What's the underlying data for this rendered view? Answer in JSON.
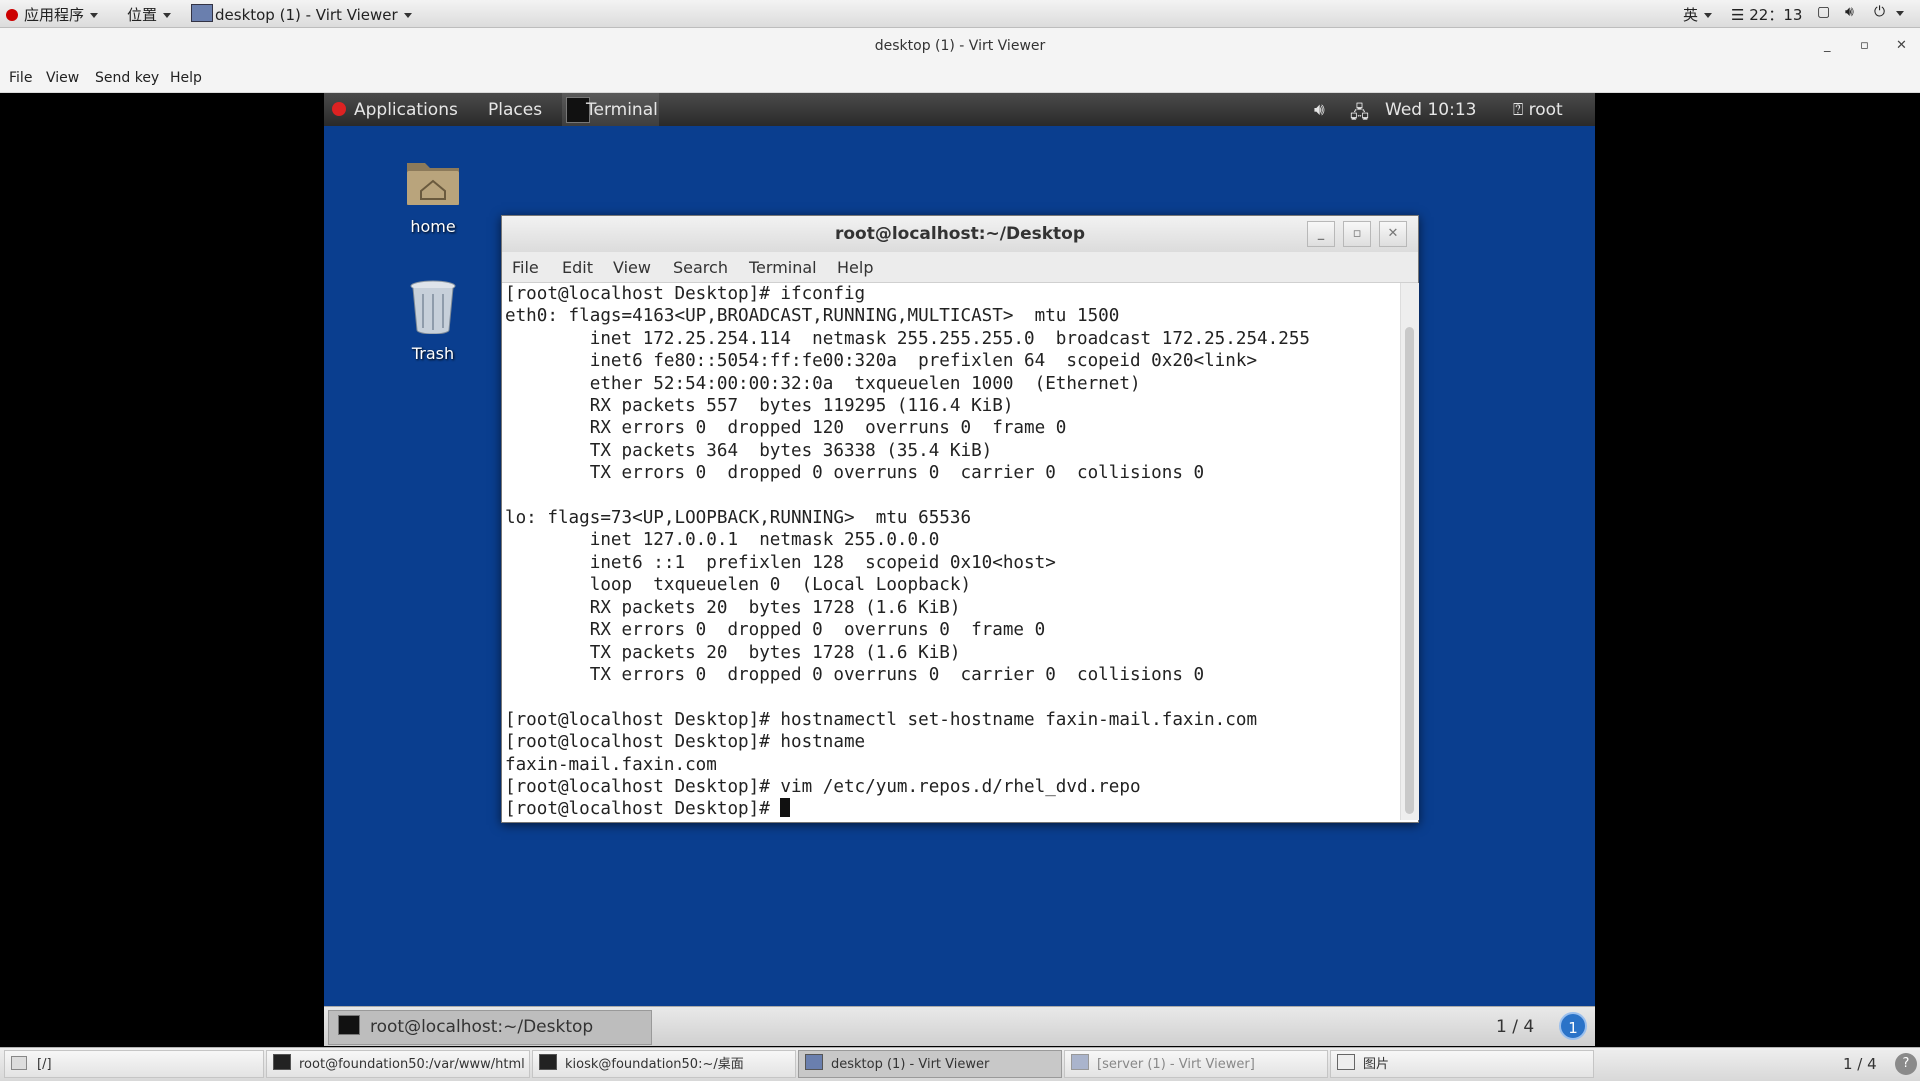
{
  "host_top": {
    "apps_menu": "应用程序",
    "places_menu": "位置",
    "window_menu": "desktop (1) - Virt Viewer",
    "input_method": "英",
    "clock": "22：13"
  },
  "viewer": {
    "title": "desktop (1) - Virt Viewer",
    "menu": [
      "File",
      "View",
      "Send key",
      "Help"
    ]
  },
  "guest": {
    "top_panel": {
      "applications": "Applications",
      "places": "Places",
      "terminal": "Terminal",
      "clock": "Wed 10:13",
      "user": "root"
    },
    "desktop_icons": [
      {
        "label": "home",
        "icon": "home-folder-icon"
      },
      {
        "label": "Trash",
        "icon": "trash-icon"
      }
    ],
    "terminal": {
      "title": "root@localhost:~/Desktop",
      "menu": [
        "File",
        "Edit",
        "View",
        "Search",
        "Terminal",
        "Help"
      ],
      "lines": [
        "[root@localhost Desktop]# ifconfig",
        "eth0: flags=4163<UP,BROADCAST,RUNNING,MULTICAST>  mtu 1500",
        "        inet 172.25.254.114  netmask 255.255.255.0  broadcast 172.25.254.255",
        "        inet6 fe80::5054:ff:fe00:320a  prefixlen 64  scopeid 0x20<link>",
        "        ether 52:54:00:00:32:0a  txqueuelen 1000  (Ethernet)",
        "        RX packets 557  bytes 119295 (116.4 KiB)",
        "        RX errors 0  dropped 120  overruns 0  frame 0",
        "        TX packets 364  bytes 36338 (35.4 KiB)",
        "        TX errors 0  dropped 0 overruns 0  carrier 0  collisions 0",
        "",
        "lo: flags=73<UP,LOOPBACK,RUNNING>  mtu 65536",
        "        inet 127.0.0.1  netmask 255.0.0.0",
        "        inet6 ::1  prefixlen 128  scopeid 0x10<host>",
        "        loop  txqueuelen 0  (Local Loopback)",
        "        RX packets 20  bytes 1728 (1.6 KiB)",
        "        RX errors 0  dropped 0  overruns 0  frame 0",
        "        TX packets 20  bytes 1728 (1.6 KiB)",
        "        TX errors 0  dropped 0 overruns 0  carrier 0  collisions 0",
        "",
        "[root@localhost Desktop]# hostnamectl set-hostname faxin-mail.faxin.com",
        "[root@localhost Desktop]# hostname",
        "faxin-mail.faxin.com",
        "[root@localhost Desktop]# vim /etc/yum.repos.d/rhel_dvd.repo"
      ],
      "prompt": "[root@localhost Desktop]# "
    },
    "bottom_panel": {
      "task": "root@localhost:~/Desktop",
      "pager": "1 / 4",
      "notification_count": "1"
    }
  },
  "host_taskbar": {
    "show_desktop": "[/]",
    "items": [
      {
        "label": "root@foundation50:/var/www/html",
        "state": "normal"
      },
      {
        "label": "kiosk@foundation50:~/桌面",
        "state": "normal"
      },
      {
        "label": "desktop (1) - Virt Viewer",
        "state": "active"
      },
      {
        "label": "[server (1) - Virt Viewer]",
        "state": "minimized"
      },
      {
        "label": "图片",
        "state": "normal"
      }
    ],
    "pager": "1 / 4",
    "help": "?"
  }
}
